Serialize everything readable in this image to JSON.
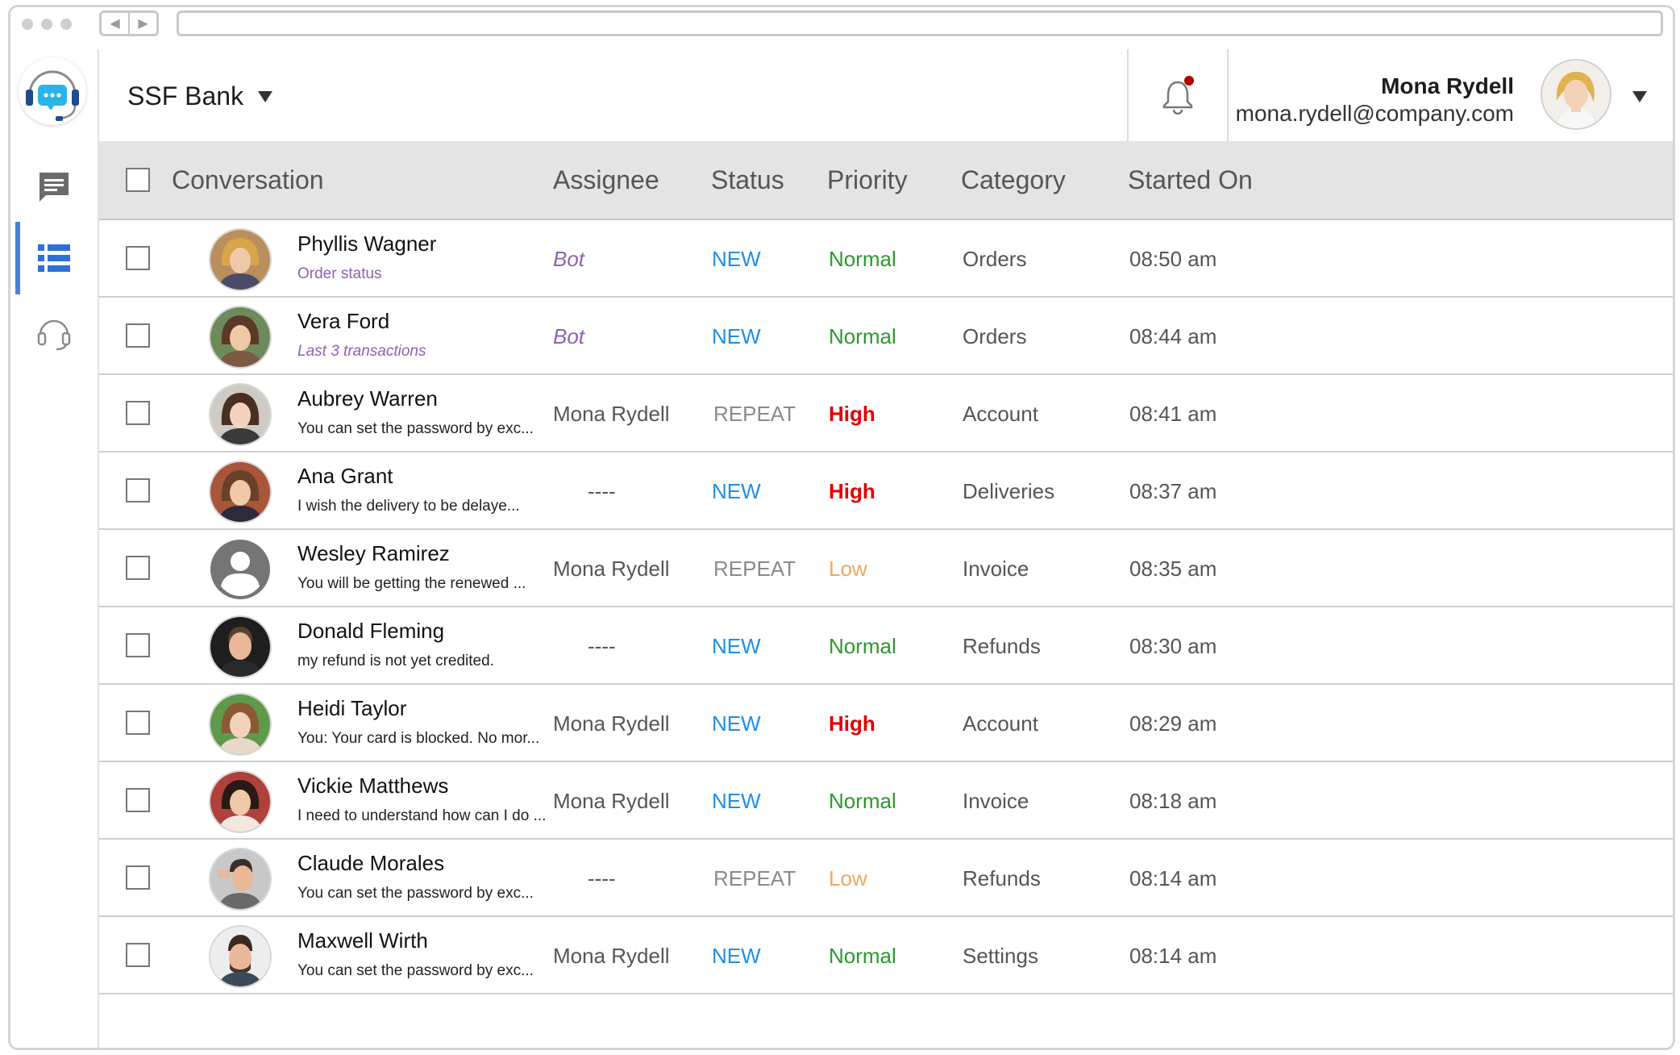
{
  "header": {
    "org_name": "SSF Bank",
    "user_name": "Mona Rydell",
    "user_email": "mona.rydell@company.com",
    "notification_dot_color": "#b00000"
  },
  "sidebar": {
    "items": [
      {
        "name": "chat-icon"
      },
      {
        "name": "list-icon",
        "active": true
      },
      {
        "name": "headset-icon"
      }
    ]
  },
  "table": {
    "headers": {
      "conversation": "Conversation",
      "assignee": "Assignee",
      "status": "Status",
      "priority": "Priority",
      "category": "Category",
      "started_on": "Started On"
    },
    "rows": [
      {
        "name": "Phyllis Wagner",
        "snippet": "Order status",
        "assignee": "Bot",
        "status": "NEW",
        "priority": "Normal",
        "category": "Orders",
        "started": "08:50 am"
      },
      {
        "name": "Vera Ford",
        "snippet": "Last 3 transactions",
        "assignee": "Bot",
        "status": "NEW",
        "priority": "Normal",
        "category": "Orders",
        "started": "08:44 am"
      },
      {
        "name": "Aubrey Warren",
        "snippet": "You can set the password by exc...",
        "assignee": "Mona Rydell",
        "status": "REPEAT",
        "priority": "High",
        "category": "Account",
        "started": "08:41 am"
      },
      {
        "name": "Ana Grant",
        "snippet": "I wish the delivery to be delaye...",
        "assignee": "----",
        "status": "NEW",
        "priority": "High",
        "category": "Deliveries",
        "started": "08:37 am"
      },
      {
        "name": "Wesley Ramirez",
        "snippet": "You will be getting the renewed ...",
        "assignee": "Mona Rydell",
        "status": "REPEAT",
        "priority": "Low",
        "category": "Invoice",
        "started": "08:35 am"
      },
      {
        "name": "Donald Fleming",
        "snippet": "my refund is not yet credited.",
        "assignee": "----",
        "status": "NEW",
        "priority": "Normal",
        "category": "Refunds",
        "started": "08:30 am"
      },
      {
        "name": "Heidi Taylor",
        "snippet": "You: Your card is blocked. No mor...",
        "assignee": "Mona Rydell",
        "status": "NEW",
        "priority": "High",
        "category": "Account",
        "started": "08:29 am"
      },
      {
        "name": "Vickie Matthews",
        "snippet": "I need to understand how can I do ...",
        "assignee": "Mona Rydell",
        "status": "NEW",
        "priority": "Normal",
        "category": "Invoice",
        "started": "08:18 am"
      },
      {
        "name": "Claude Morales",
        "snippet": "You can set the password by exc...",
        "assignee": "----",
        "status": "REPEAT",
        "priority": "Low",
        "category": "Refunds",
        "started": "08:14 am"
      },
      {
        "name": "Maxwell Wirth",
        "snippet": "You can set the password by exc...",
        "assignee": "Mona Rydell",
        "status": "NEW",
        "priority": "Normal",
        "category": "Settings",
        "started": "08:14 am"
      }
    ]
  }
}
